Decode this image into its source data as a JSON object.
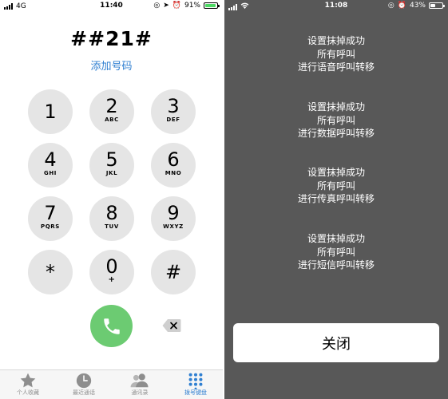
{
  "left_status": {
    "carrier": "4G",
    "time": "11:40",
    "battery": "91%",
    "battery_level": 0.91,
    "battery_color": "#4cd964"
  },
  "dialer": {
    "dialed": "##21#",
    "add_number": "添加号码",
    "keys": [
      {
        "digit": "1",
        "letters": ""
      },
      {
        "digit": "2",
        "letters": "ABC"
      },
      {
        "digit": "3",
        "letters": "DEF"
      },
      {
        "digit": "4",
        "letters": "GHI"
      },
      {
        "digit": "5",
        "letters": "JKL"
      },
      {
        "digit": "6",
        "letters": "MNO"
      },
      {
        "digit": "7",
        "letters": "PQRS"
      },
      {
        "digit": "8",
        "letters": "TUV"
      },
      {
        "digit": "9",
        "letters": "WXYZ"
      },
      {
        "digit": "*",
        "letters": ""
      },
      {
        "digit": "0",
        "letters": "+"
      },
      {
        "digit": "#",
        "letters": ""
      }
    ],
    "call_icon": "phone-icon",
    "call_color": "#6ccb72",
    "backspace_icon": "backspace-icon"
  },
  "tabbar": {
    "tabs": [
      {
        "label": "个人收藏",
        "icon": "star-icon",
        "active": false
      },
      {
        "label": "最近通话",
        "icon": "clock-icon",
        "active": false
      },
      {
        "label": "通讯录",
        "icon": "contacts-icon",
        "active": false
      },
      {
        "label": "拨号键盘",
        "icon": "keypad-icon",
        "active": true
      }
    ],
    "active_color": "#2f7fd1"
  },
  "right_status": {
    "time": "11:08",
    "battery": "43%",
    "battery_level": 0.43
  },
  "result": {
    "messages": [
      {
        "line1": "设置抹掉成功",
        "line2": "所有呼叫",
        "line3": "进行语音呼叫转移"
      },
      {
        "line1": "设置抹掉成功",
        "line2": "所有呼叫",
        "line3": "进行数据呼叫转移"
      },
      {
        "line1": "设置抹掉成功",
        "line2": "所有呼叫",
        "line3": "进行传真呼叫转移"
      },
      {
        "line1": "设置抹掉成功",
        "line2": "所有呼叫",
        "line3": "进行短信呼叫转移"
      }
    ],
    "close_label": "关闭",
    "background": "#585858"
  }
}
